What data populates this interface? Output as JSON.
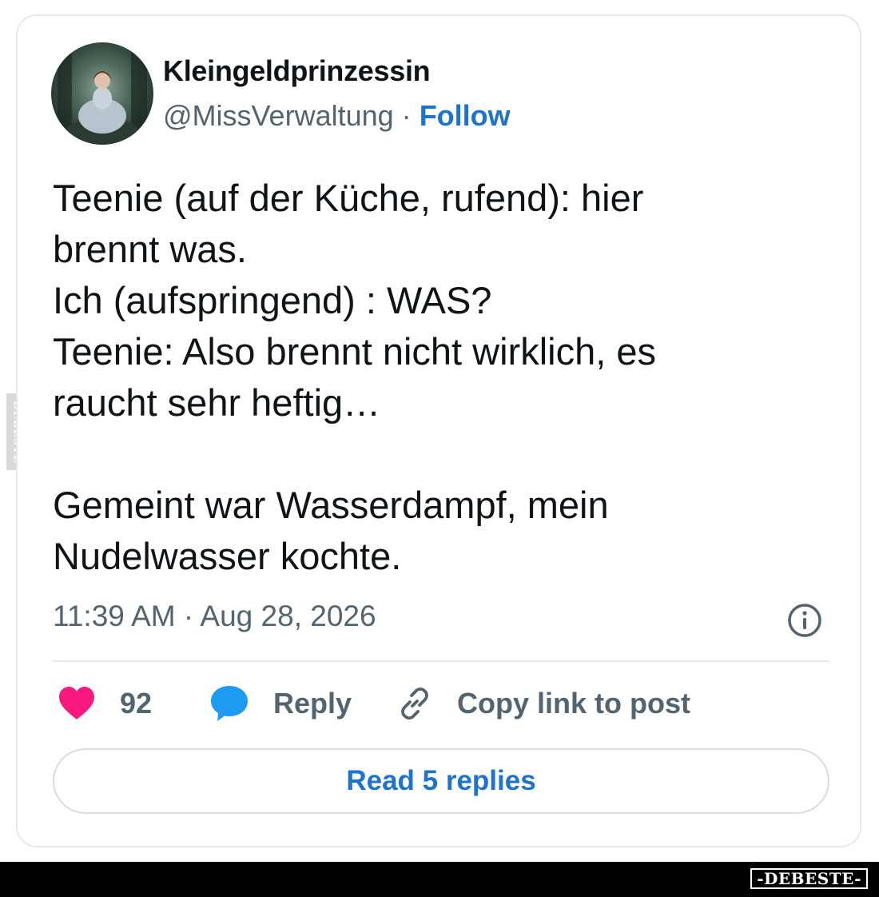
{
  "author": {
    "display_name": "Kleingeldprinzessin",
    "handle": "@MissVerwaltung",
    "separator": "·",
    "follow_label": "Follow"
  },
  "tweet": {
    "text": "Teenie (auf der Küche, rufend): hier\nbrennt was.\nIch (aufspringend) : WAS?\nTeenie: Also brennt nicht wirklich, es\nraucht sehr heftig…\n\nGemeint war Wasserdampf, mein\nNudelwasser kochte.",
    "timestamp": "11:39 AM · Aug 28, 2026"
  },
  "actions": {
    "like_count": "92",
    "reply_label": "Reply",
    "copy_link_label": "Copy link to post",
    "read_replies_label": "Read 5 replies"
  },
  "icons": {
    "like": "heart-icon",
    "reply": "speech-bubble-icon",
    "copy": "link-icon",
    "info": "info-icon"
  },
  "colors": {
    "like": "#f91880",
    "reply": "#1d9bf0",
    "link": "#1d74d0",
    "secondary_text": "#536471"
  },
  "watermarks": {
    "side": "DEBESTE",
    "footer": "-DEBESTE-"
  }
}
